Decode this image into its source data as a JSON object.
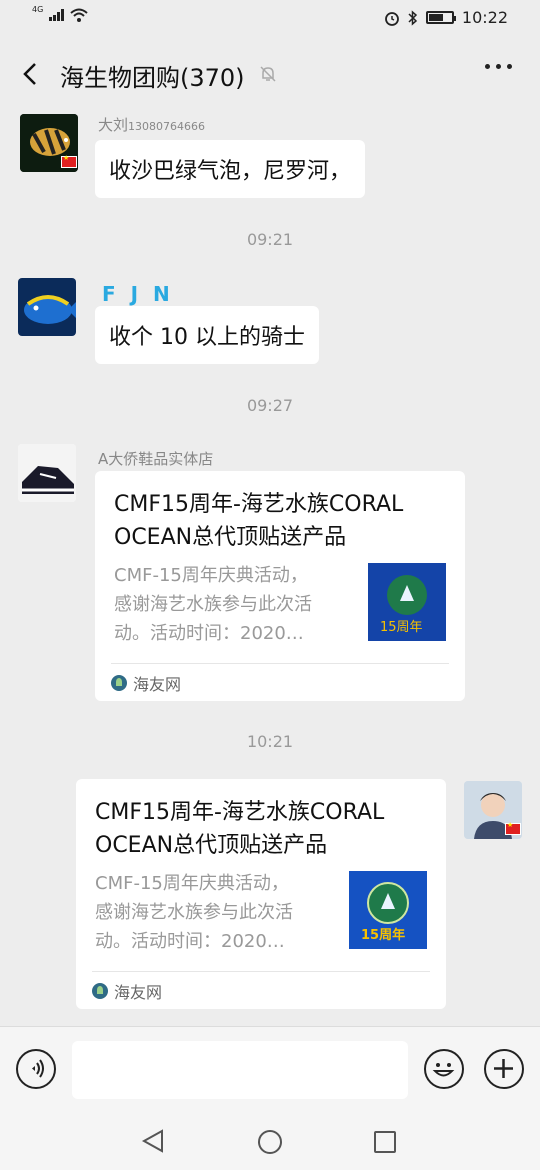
{
  "status_bar": {
    "network": "4G",
    "time": "10:22",
    "battery_level": 0.6
  },
  "header": {
    "title": "海生物团购(370)",
    "icons": [
      "back-icon",
      "mute-icon",
      "more-icon"
    ]
  },
  "messages": [
    {
      "sender": "大刘",
      "sender_suffix": "13080764666",
      "text": "收沙巴绿气泡，尼罗河，"
    },
    {
      "time": "09:21"
    },
    {
      "sender": "F J N",
      "text": "收个 10 以上的骑士"
    },
    {
      "time": "09:27"
    },
    {
      "sender": "A大侨鞋品实体店",
      "card": {
        "title": "CMF15周年-海艺水族CORAL OCEAN总代顶贴送产品",
        "description": "CMF-15周年庆典活动，\n感谢海艺水族参与此次活\n动。活动时间：2020…",
        "thumb_text": "15周年",
        "source": "海友网"
      }
    },
    {
      "time": "10:21"
    },
    {
      "sender": "me",
      "card": {
        "title": "CMF15周年-海艺水族CORAL OCEAN总代顶贴送产品",
        "description": "CMF-15周年庆典活动，\n感谢海艺水族参与此次活\n动。活动时间：2020…",
        "thumb_text": "15周年",
        "source": "海友网"
      }
    }
  ],
  "input_bar": {
    "icons": [
      "voice-icon",
      "emoji-icon",
      "plus-icon"
    ],
    "value": ""
  },
  "nav_bar": {
    "icons": [
      "nav-back-icon",
      "nav-home-icon",
      "nav-recent-icon"
    ]
  }
}
